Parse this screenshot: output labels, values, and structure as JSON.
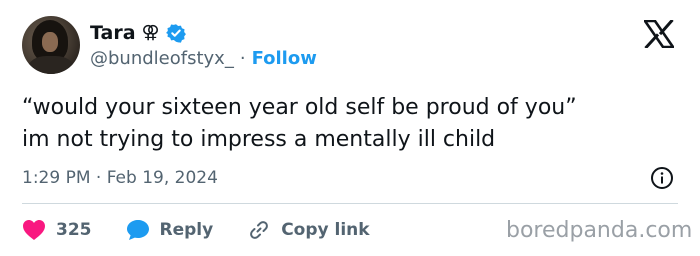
{
  "user": {
    "display_name": "Tara",
    "symbol": "⚢",
    "handle": "@bundleofstyx_",
    "separator": "·",
    "follow_label": "Follow"
  },
  "tweet": {
    "line1": "“would your sixteen year old self be proud of you”",
    "line2": "im not trying to impress a mentally ill child",
    "timestamp": "1:29 PM · Feb 19, 2024"
  },
  "actions": {
    "like_count": "325",
    "reply_label": "Reply",
    "copy_link_label": "Copy link"
  },
  "watermark": "boredpanda.com",
  "icons": {
    "brand": "x-logo-icon",
    "verified": "verified-badge-icon",
    "like": "heart-icon",
    "reply": "speech-bubble-icon",
    "copy": "link-icon",
    "info": "info-icon"
  },
  "colors": {
    "accent": "#1d9bf0",
    "heart": "#f91880",
    "muted": "#536471",
    "text": "#0f1419"
  }
}
